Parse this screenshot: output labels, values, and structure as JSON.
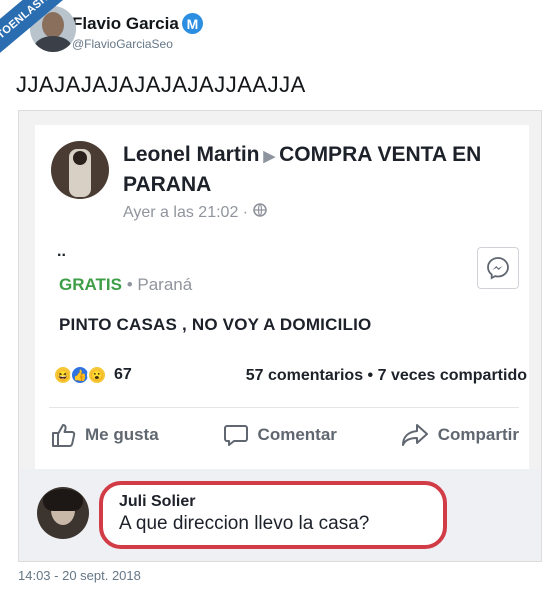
{
  "watermark": "VISTOENLASREDES",
  "tweet": {
    "author_name": "Flavio Garcia",
    "verified_mark": "M",
    "author_handle": "@FlavioGarciaSeo",
    "text": "JJAJAJAJAJAJAJAJJAAJJA",
    "timestamp": "14:03 - 20 sept. 2018"
  },
  "fb_post": {
    "author": "Leonel Martin",
    "group": "COMPRA VENTA EN PARANA",
    "time": "Ayer a las 21:02",
    "dots": "..",
    "price": "GRATIS",
    "location": "Paraná",
    "body": "PINTO CASAS , NO VOY A DOMICILIO",
    "reaction_count": "67",
    "stats": "57 comentarios • 7 veces compartido",
    "actions": {
      "like": "Me gusta",
      "comment": "Comentar",
      "share": "Compartir"
    }
  },
  "fb_comment": {
    "author": "Juli Solier",
    "text": "A que direccion llevo la casa?"
  },
  "colors": {
    "verified": "#2c8ee0",
    "price_green": "#3e9e47",
    "highlight_red": "#d13c47",
    "banner_blue": "#2a6db0"
  }
}
